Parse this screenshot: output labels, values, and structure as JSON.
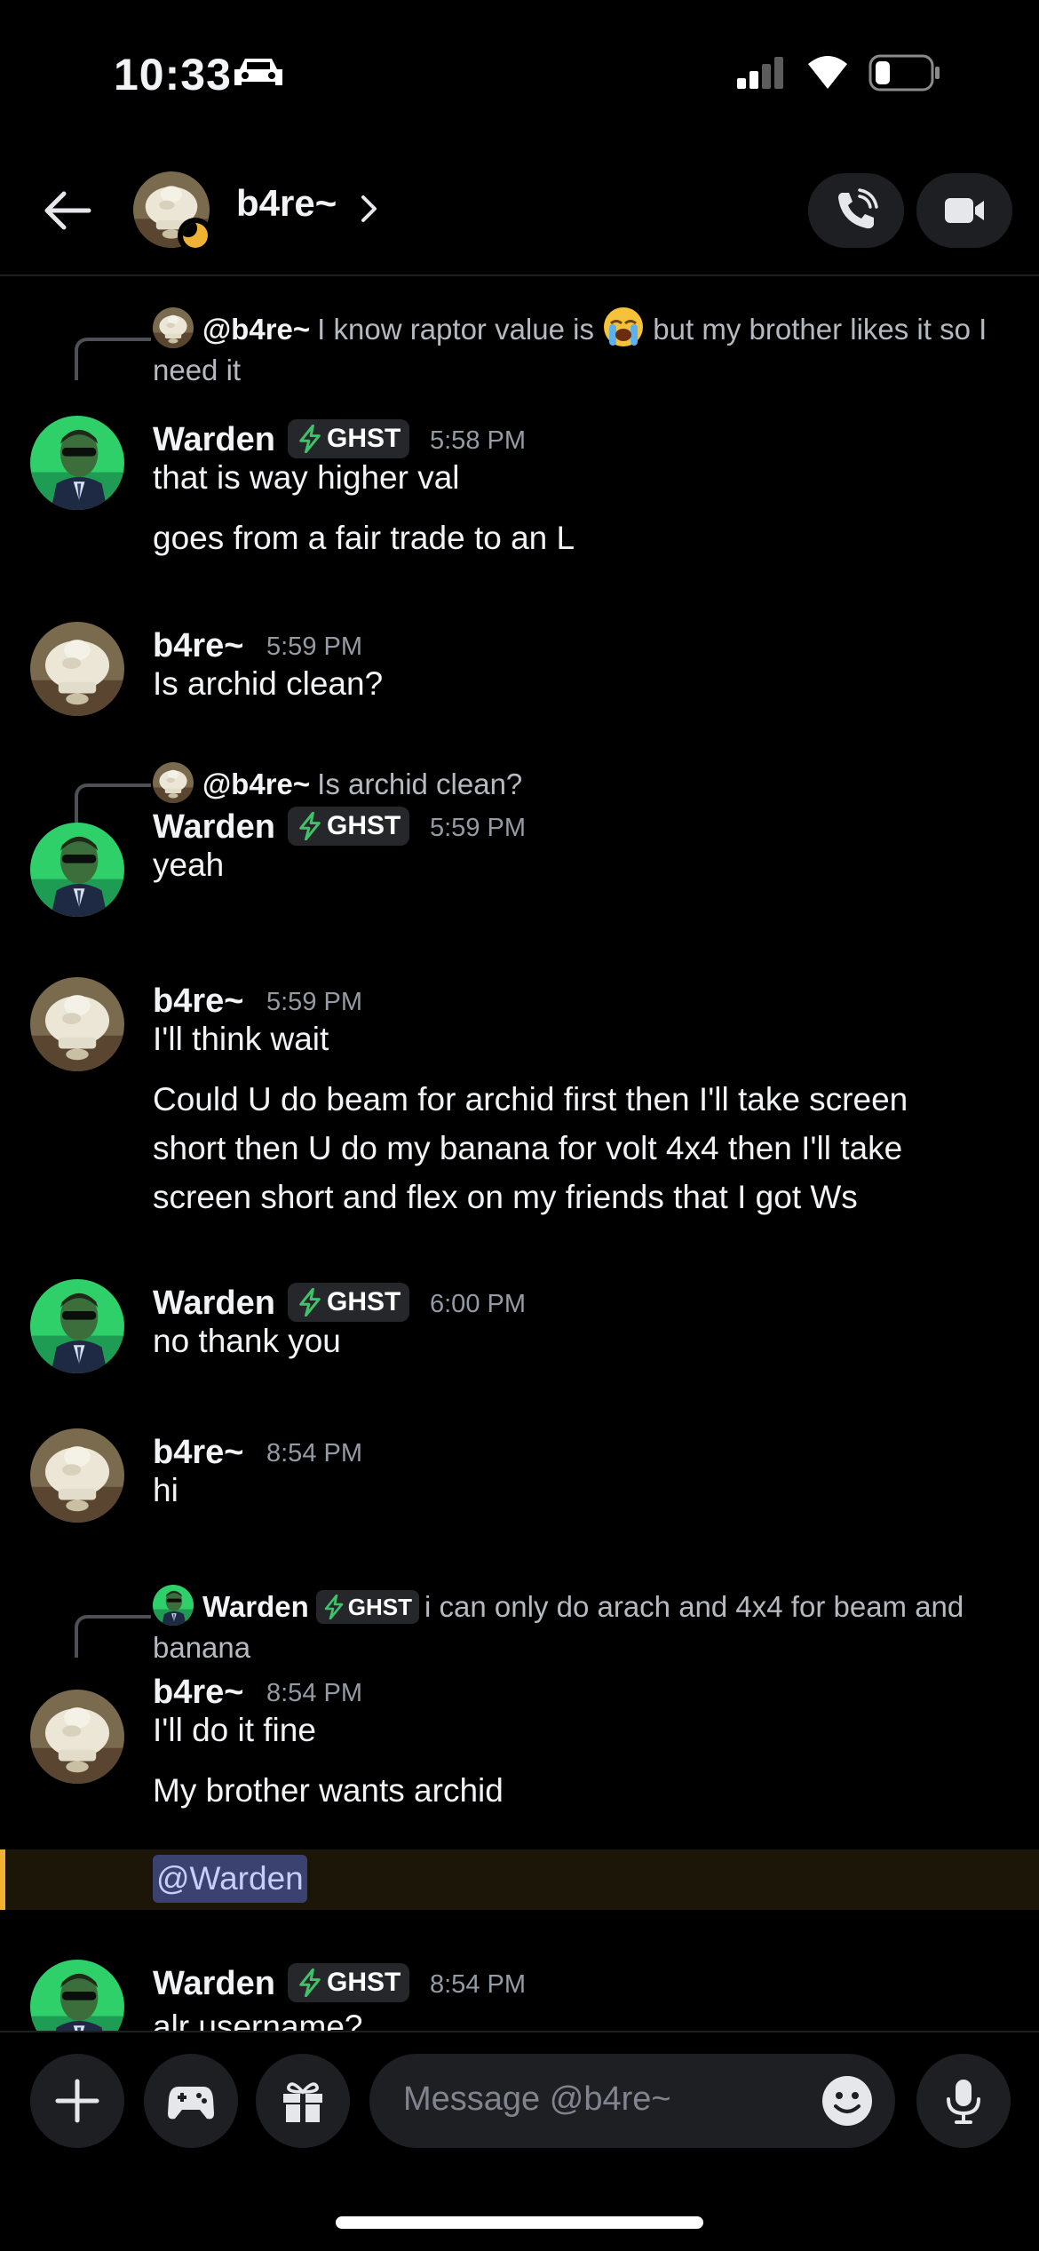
{
  "status_bar": {
    "time": "10:33"
  },
  "header": {
    "name": "b4re~"
  },
  "messages": [
    {
      "reply": {
        "author": "@b4re~",
        "text": "I know raptor value is 😭 but my brother likes it so I need it"
      },
      "author": "Warden",
      "tag": "GHST",
      "time": "5:58 PM",
      "lines": [
        "that is way higher val",
        "goes from a fair trade to an L"
      ]
    },
    {
      "author": "b4re~",
      "time": "5:59 PM",
      "lines": [
        "Is archid clean?"
      ]
    },
    {
      "reply": {
        "author": "@b4re~",
        "text": "Is archid clean?"
      },
      "author": "Warden",
      "tag": "GHST",
      "time": "5:59 PM",
      "lines": [
        "yeah"
      ]
    },
    {
      "author": "b4re~",
      "time": "5:59 PM",
      "lines": [
        "I'll think wait",
        "Could U do beam for archid first then I'll take screen",
        "short then U do my banana for volt 4x4 then I'll take",
        "screen short and flex on my friends that I got Ws"
      ]
    },
    {
      "author": "Warden",
      "tag": "GHST",
      "time": "6:00 PM",
      "lines": [
        "no thank you"
      ]
    },
    {
      "author": "b4re~",
      "time": "8:54 PM",
      "lines": [
        "hi"
      ]
    },
    {
      "reply": {
        "author": "Warden",
        "tag": "GHST",
        "text": "i can only do arach and 4x4 for beam and banana"
      },
      "author": "b4re~",
      "time": "8:54 PM",
      "lines": [
        "I'll do it fine",
        "My brother wants archid"
      ],
      "mention": "@Warden"
    },
    {
      "author": "Warden",
      "tag": "GHST",
      "time": "8:54 PM",
      "lines": [
        "alr username?"
      ]
    }
  ],
  "composer": {
    "placeholder": "Message @b4re~"
  }
}
